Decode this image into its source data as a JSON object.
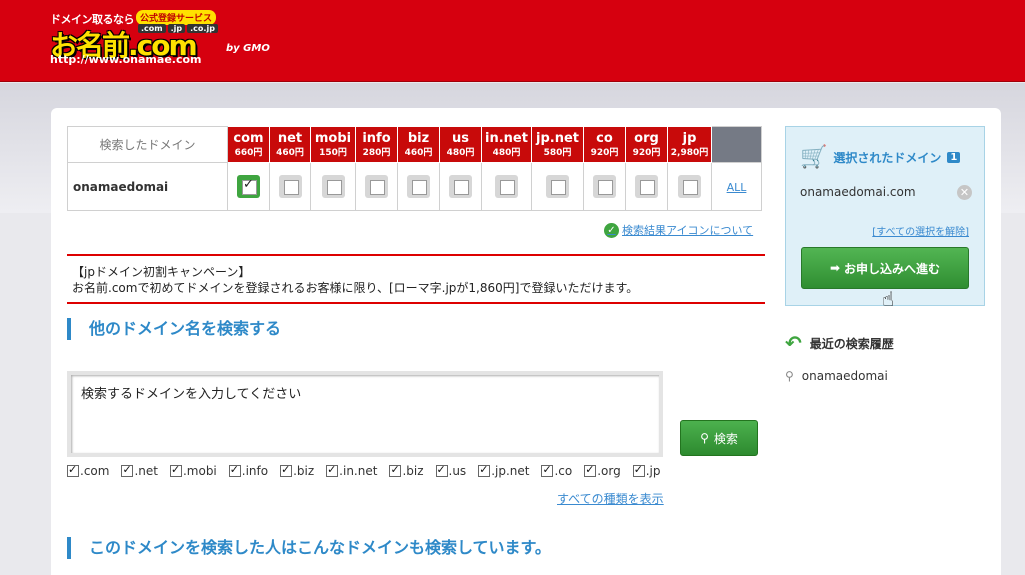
{
  "header": {
    "tagline": "ドメイン取るなら",
    "badge": "公式登録サービス",
    "tlds": [
      ".com",
      ".jp",
      ".co.jp"
    ],
    "brand": "お名前.com",
    "by": "by GMO",
    "url": "http://www.onamae.com"
  },
  "results": {
    "header_label": "検索したドメイン",
    "domain": "onamaedomai",
    "tlds": [
      {
        "name": "com",
        "price": "660円",
        "checked": true
      },
      {
        "name": "net",
        "price": "460円",
        "checked": false
      },
      {
        "name": "mobi",
        "price": "150円",
        "checked": false
      },
      {
        "name": "info",
        "price": "280円",
        "checked": false
      },
      {
        "name": "biz",
        "price": "460円",
        "checked": false
      },
      {
        "name": "us",
        "price": "480円",
        "checked": false
      },
      {
        "name": "in.net",
        "price": "480円",
        "checked": false
      },
      {
        "name": "jp.net",
        "price": "580円",
        "checked": false
      },
      {
        "name": "co",
        "price": "920円",
        "checked": false
      },
      {
        "name": "org",
        "price": "920円",
        "checked": false
      },
      {
        "name": "jp",
        "price": "2,980円",
        "checked": false
      }
    ],
    "all_link": "ALL",
    "icon_info_link": "検索結果アイコンについて"
  },
  "campaign": {
    "title": "【jpドメイン初割キャンペーン】",
    "body": "お名前.comで初めてドメインを登録されるお客様に限り、[ローマ字.jpが1,860円]で登録いただけます。"
  },
  "other_search": {
    "title": "他のドメイン名を検索する",
    "placeholder": "検索するドメインを入力してください",
    "search_button": "検索",
    "filters": [
      ".com",
      ".net",
      ".mobi",
      ".info",
      ".biz",
      ".in.net",
      ".biz",
      ".us",
      ".jp.net",
      ".co",
      ".org",
      ".jp"
    ],
    "show_all_link": "すべての種類を表示"
  },
  "related_section_title": "このドメインを検索した人はこんなドメインも検索しています。",
  "cart": {
    "title": "選択されたドメイン",
    "count": "1",
    "item": "onamaedomai.com",
    "clear_link": "[すべての選択を解除]",
    "proceed_button": "お申し込みへ進む"
  },
  "history": {
    "title": "最近の検索履歴",
    "items": [
      "onamaedomai"
    ]
  },
  "colors": {
    "header_red": "#d6000f",
    "tld_header_red": "#c80a0a",
    "accent_blue": "#2e89c8",
    "button_green": "#3fa540"
  }
}
